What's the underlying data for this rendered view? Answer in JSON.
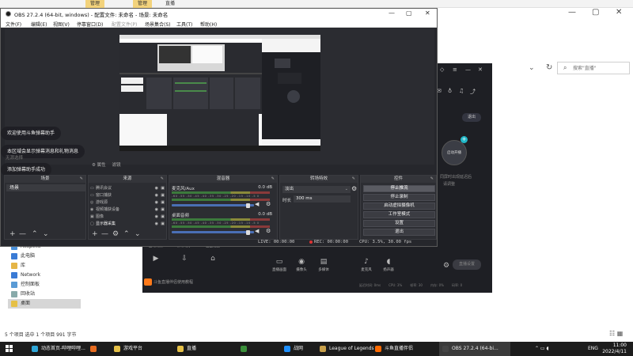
{
  "explorer": {
    "tabs": [
      {
        "label": "管理",
        "highlight": true
      },
      {
        "label": "管理",
        "highlight": true
      },
      {
        "label": "直播",
        "highlight": false
      }
    ],
    "search_placeholder": "搜索\"直播\"",
    "nav_items": [
      {
        "label": "Acapella",
        "icon": "user-folder-icon",
        "color": "#4a8fd8"
      },
      {
        "label": "此电脑",
        "icon": "computer-icon",
        "color": "#3a7bd5"
      },
      {
        "label": "库",
        "icon": "library-icon",
        "color": "#e5b547"
      },
      {
        "label": "Network",
        "icon": "network-icon",
        "color": "#3a7bd5"
      },
      {
        "label": "控制面板",
        "icon": "control-panel-icon",
        "color": "#5a9bd5"
      },
      {
        "label": "回收站",
        "icon": "recycle-bin-icon",
        "color": "#8aa"
      },
      {
        "label": "桌面",
        "icon": "desktop-folder-icon",
        "color": "#e5c047",
        "selected": true
      }
    ],
    "status": "5 个项目    选中 1 个项目  991 字节"
  },
  "douyu": {
    "exit_label": "退出",
    "start_stream_circle": "启动开播",
    "hint1": "同屏时出现延迟后",
    "hint2": "请调整",
    "left_tools": [
      {
        "icon": "mic-fx-icon",
        "glyph": "✦",
        "label": "互动玩法"
      },
      {
        "icon": "sticker-icon",
        "glyph": "▣",
        "label": "弹幕助手"
      },
      {
        "icon": "frame-icon",
        "glyph": "▢",
        "label": "画面设置"
      },
      {
        "icon": "live-room-icon",
        "glyph": "▶",
        "label": ""
      },
      {
        "icon": "download-icon",
        "glyph": "⇩",
        "label": ""
      },
      {
        "icon": "wifi-icon",
        "glyph": "⌂",
        "label": ""
      }
    ],
    "live_text": "斗鱼直播伴侣使用教程",
    "bottom_tools": [
      {
        "icon": "screen-share-icon",
        "glyph": "▭",
        "label": "直播画面"
      },
      {
        "icon": "camera-icon",
        "glyph": "◉",
        "label": "摄像头"
      },
      {
        "icon": "media-icon",
        "glyph": "▤",
        "label": "多媒体"
      },
      {
        "icon": "mic-icon",
        "glyph": "♪",
        "label": "麦克风"
      },
      {
        "icon": "speaker-icon",
        "glyph": "◖",
        "label": "扬声器"
      }
    ],
    "start_live_label": "直播设置",
    "stats": [
      "延迟时间: 0ms",
      "CPU: 3%",
      "帧率: 30",
      "内存: 0%",
      "码率: 0"
    ]
  },
  "obs": {
    "title": "OBS 27.2.4 (64-bit, windows) - 配置文件: 未命名 - 场景: 未命名",
    "menu": [
      {
        "label": "文件(F)",
        "disabled": false
      },
      {
        "label": "编辑(E)",
        "disabled": false
      },
      {
        "label": "视图(V)",
        "disabled": false
      },
      {
        "label": "停靠窗口(D)",
        "disabled": false
      },
      {
        "label": "配置文件(P)",
        "disabled": true
      },
      {
        "label": "场景集合(S)",
        "disabled": false
      },
      {
        "label": "工具(T)",
        "disabled": false
      },
      {
        "label": "帮助(H)",
        "disabled": false
      }
    ],
    "chat_messages": [
      "欢迎使用斗鱼弹幕助手",
      "本区域会显示弹幕消息和礼物消息",
      "添加弹幕助手成功"
    ],
    "faint_text": "无源选择",
    "mini_props": [
      "⚙ 属性",
      "滤镜"
    ],
    "docks": {
      "scenes_title": "场景",
      "sources_title": "来源",
      "mixer_title": "混音器",
      "transitions_title": "转场特效",
      "controls_title": "控件"
    },
    "scenes": [
      "场景"
    ],
    "sources": [
      {
        "name": "腾讯会议",
        "icon": "window-icon",
        "active": false
      },
      {
        "name": "窗口捕获",
        "icon": "window-icon",
        "active": false
      },
      {
        "name": "游戏源",
        "icon": "gamepad-icon",
        "active": false
      },
      {
        "name": "视频捕获设备",
        "icon": "camera-icon",
        "active": false
      },
      {
        "name": "图像",
        "icon": "image-icon",
        "active": false
      },
      {
        "name": "显示器采集",
        "icon": "monitor-icon",
        "active": true
      }
    ],
    "mixer": [
      {
        "name": "麦克风/Aux",
        "db": "0.0 dB",
        "volume": 0.92
      },
      {
        "name": "桌面音频",
        "db": "0.0 dB",
        "volume": 0.92
      }
    ],
    "mixer_ticks": "-60 -55 -50 -45 -40 -35 -30 -25 -20 -15 -10 -5 0",
    "transition": {
      "type": "淡出",
      "duration_label": "时长",
      "duration": "300 ms"
    },
    "controls": [
      "停止推流",
      "停止录制",
      "启动虚拟摄像机",
      "工作室模式",
      "设置",
      "退出"
    ],
    "status": {
      "live": "LIVE: 00:00:00",
      "rec": "REC: 00:00:00",
      "cpu": "CPU: 3.5%, 30.00 fps"
    }
  },
  "taskbar": {
    "items": [
      {
        "label": "动态首页-哔哩哔哩...",
        "icon": "browser-icon",
        "color": "#2fa7d8"
      },
      {
        "label": "",
        "icon": "firefox-icon",
        "color": "#e66b1f"
      },
      {
        "label": "游戏平台",
        "icon": "folder-icon",
        "color": "#e5c047"
      },
      {
        "label": "直播",
        "icon": "folder-icon",
        "color": "#e5c047"
      },
      {
        "label": "",
        "icon": "chrome-icon",
        "color": "#3a8f3a"
      },
      {
        "label": "战网",
        "icon": "battlenet-icon",
        "color": "#1e90ff"
      },
      {
        "label": "League of Legends",
        "icon": "lol-icon",
        "color": "#c8a04a"
      },
      {
        "label": "斗鱼直播伴侣",
        "icon": "douyu-icon",
        "color": "#ff6a00"
      },
      {
        "label": "OBS 27.2.4 (64-bi...",
        "icon": "obs-icon",
        "color": "#444"
      }
    ],
    "lang": "ENG",
    "time": "11:00",
    "date": "2022/4/11"
  }
}
